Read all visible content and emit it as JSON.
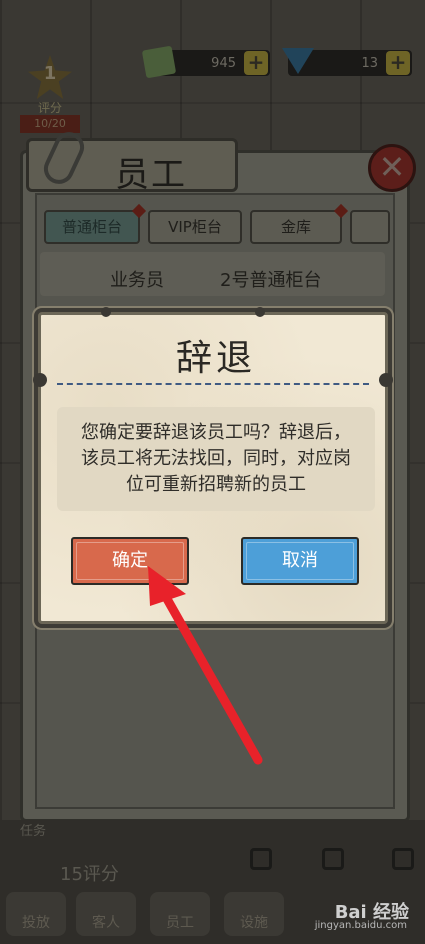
{
  "hud": {
    "money": "945",
    "gems": "13",
    "rating_level": "1",
    "rating_label": "评分",
    "rating_value": "10/20"
  },
  "panel": {
    "title": "员工",
    "tabs": [
      "普通柜台",
      "VIP柜台",
      "金库"
    ],
    "info_role": "业务员",
    "info_counter": "2号普通柜台"
  },
  "dialog": {
    "title": "辞退",
    "message": "您确定要辞退该员工吗？辞退后，该员工将无法找回，同时，对应岗位可重新招聘新的员工",
    "confirm_label": "确定",
    "cancel_label": "取消"
  },
  "bottom": {
    "task_label": "任务",
    "rating": "15",
    "rating_suffix": "评分",
    "nav": [
      "投放",
      "客人",
      "员工",
      "设施"
    ]
  },
  "watermark": {
    "brand": "Bai 经验",
    "url": "jingyan.baidu.com"
  },
  "colors": {
    "confirm": "#d8694c",
    "cancel": "#4d9fd8",
    "annotation_arrow": "#e8222a",
    "divider": "#3f5a82"
  },
  "icons": {
    "close": "close-x-icon",
    "plus": "plus-icon",
    "lock": "lock-icon"
  }
}
